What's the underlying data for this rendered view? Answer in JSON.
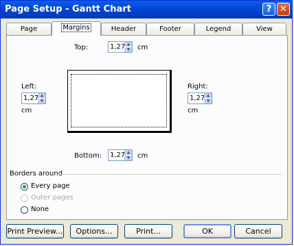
{
  "window": {
    "title": "Page Setup - Gantt Chart",
    "help_glyph": "?",
    "close_glyph": "✕"
  },
  "tabs": [
    {
      "label": "Page"
    },
    {
      "label": "Margins"
    },
    {
      "label": "Header"
    },
    {
      "label": "Footer"
    },
    {
      "label": "Legend"
    },
    {
      "label": "View"
    }
  ],
  "margins": {
    "top": {
      "label": "Top:",
      "value": "1,27",
      "unit": "cm"
    },
    "left": {
      "label": "Left:",
      "value": "1,27",
      "unit": "cm"
    },
    "right": {
      "label": "Right:",
      "value": "1,27",
      "unit": "cm"
    },
    "bottom": {
      "label": "Bottom:",
      "value": "1,27",
      "unit": "cm"
    }
  },
  "borders": {
    "label": "Borders around",
    "options": [
      {
        "label": "Every page",
        "checked": true,
        "disabled": false
      },
      {
        "label": "Outer pages",
        "checked": false,
        "disabled": true
      },
      {
        "label": "None",
        "checked": false,
        "disabled": false
      }
    ]
  },
  "buttons": {
    "print_preview": "Print Preview...",
    "options": "Options...",
    "print": "Print...",
    "ok": "OK",
    "cancel": "Cancel"
  },
  "icons": {
    "up": "▲",
    "down": "▼"
  }
}
